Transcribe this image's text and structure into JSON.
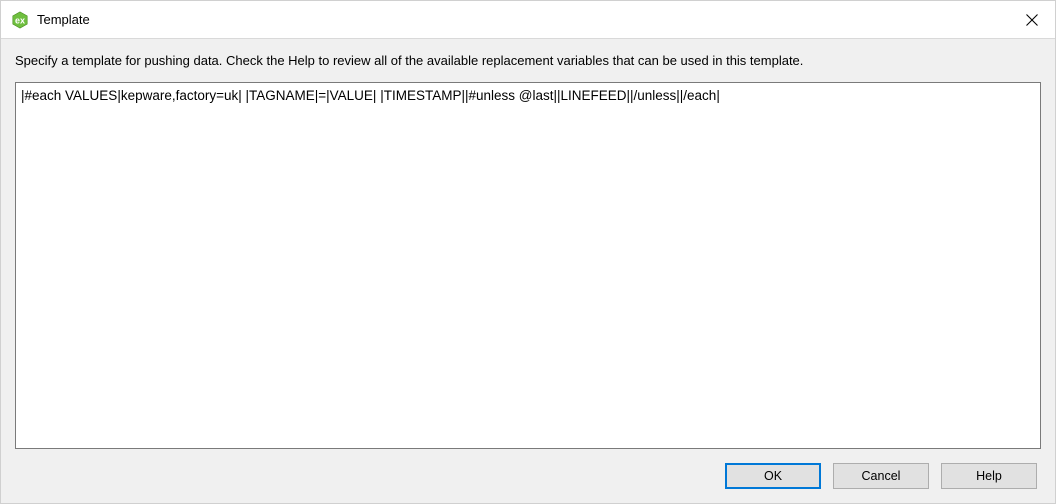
{
  "window": {
    "title": "Template"
  },
  "instruction": "Specify a template for pushing data. Check the Help to review all of the available replacement variables that can be used in this template.",
  "template_value": "|#each VALUES|kepware,factory=uk| |TAGNAME|=|VALUE| |TIMESTAMP||#unless @last||LINEFEED||/unless||/each|",
  "buttons": {
    "ok": "OK",
    "cancel": "Cancel",
    "help": "Help"
  }
}
